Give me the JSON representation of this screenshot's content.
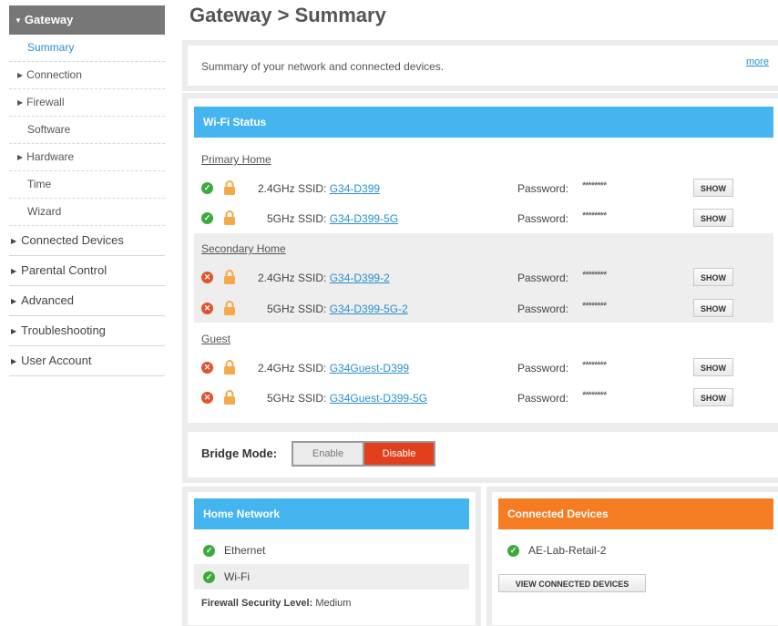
{
  "sidebar": {
    "header": "Gateway",
    "sub_items": [
      {
        "label": "Summary"
      },
      {
        "label": "Connection"
      },
      {
        "label": "Firewall"
      },
      {
        "label": "Software"
      },
      {
        "label": "Hardware"
      },
      {
        "label": "Time"
      },
      {
        "label": "Wizard"
      }
    ],
    "main_items": [
      {
        "label": "Connected Devices"
      },
      {
        "label": "Parental Control"
      },
      {
        "label": "Advanced"
      },
      {
        "label": "Troubleshooting"
      },
      {
        "label": "User Account"
      }
    ]
  },
  "page_title": "Gateway > Summary",
  "summary": {
    "text": "Summary of your network and connected devices.",
    "more": "more"
  },
  "wifi": {
    "title": "Wi-Fi Status",
    "password_label": "Password:",
    "password_mask": "********",
    "show_label": "SHOW",
    "sections": [
      {
        "name": "Primary Home",
        "networks": [
          {
            "band_label": "2.4GHz SSID:",
            "ssid": "G34-D399",
            "status": "ok"
          },
          {
            "band_label": "5GHz SSID:",
            "ssid": "G34-D399-5G",
            "status": "ok"
          }
        ]
      },
      {
        "name": "Secondary Home",
        "networks": [
          {
            "band_label": "2.4GHz SSID:",
            "ssid": "G34-D399-2",
            "status": "error"
          },
          {
            "band_label": "5GHz SSID:",
            "ssid": "G34-D399-5G-2",
            "status": "error"
          }
        ]
      },
      {
        "name": "Guest",
        "networks": [
          {
            "band_label": "2.4GHz SSID:",
            "ssid": "G34Guest-D399",
            "status": "error"
          },
          {
            "band_label": "5GHz SSID:",
            "ssid": "G34Guest-D399-5G",
            "status": "error"
          }
        ]
      }
    ]
  },
  "bridge": {
    "label": "Bridge Mode:",
    "enable": "Enable",
    "disable": "Disable",
    "selected": "Disable"
  },
  "home_network": {
    "title": "Home Network",
    "items": [
      {
        "label": "Ethernet",
        "status": "ok"
      },
      {
        "label": "Wi-Fi",
        "status": "ok"
      }
    ],
    "firewall_label": "Firewall Security Level:",
    "firewall_value": "Medium"
  },
  "connected_devices": {
    "title": "Connected Devices",
    "devices": [
      {
        "name": "AE-Lab-Retail-2",
        "status": "ok"
      }
    ],
    "view_button": "VIEW CONNECTED DEVICES"
  },
  "colors": {
    "accent_blue": "#45b5ef",
    "accent_orange": "#f57c22",
    "disable_red": "#e2401c",
    "ok_green": "#3daa3d",
    "error_red": "#e2532d",
    "sidebar_header": "#777777"
  },
  "icons": {
    "ok": "check-circle-icon",
    "error": "x-circle-icon",
    "lock": "lock-icon",
    "expand": "caret-right-icon",
    "collapse": "caret-down-icon"
  }
}
